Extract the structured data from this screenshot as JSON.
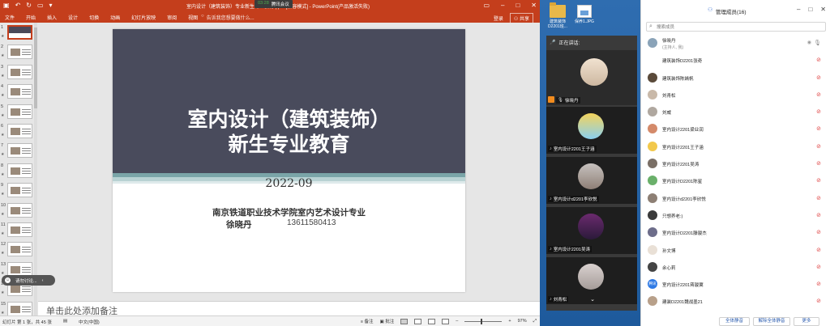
{
  "ppt": {
    "window_title": "室内设计（建筑装饰）专业新生专业教育.pptx [兼容模式] - PowerPoint(产品激活失败)",
    "meeting_badge": "腾讯会议",
    "meeting_time": "03:28",
    "tabs": [
      "文件",
      "开始",
      "插入",
      "设计",
      "切换",
      "动画",
      "幻灯片放映",
      "审阅",
      "视图"
    ],
    "tell_me": "告诉我您想要做什么...",
    "sign_in": "登录",
    "share": "共享",
    "slide": {
      "title_line1": "室内设计（建筑装饰）",
      "title_line2": "新生专业教育",
      "date": "2022-09",
      "school": "南京铁道职业技术学院室内艺术设计专业",
      "presenter": "徐晓丹",
      "phone": "13611580413"
    },
    "notes_placeholder": "单击此处添加备注",
    "chat_popup": "请勿讨论...",
    "status": {
      "slide_info": "幻灯片 第 1 张，共 45 张",
      "language": "中文(中国)",
      "notes": "备注",
      "comments": "批注",
      "zoom": "97%"
    },
    "thumb_numbers": [
      "1",
      "2",
      "3",
      "4",
      "5",
      "6",
      "7",
      "8",
      "9",
      "10",
      "11",
      "12",
      "13",
      "14",
      "15"
    ]
  },
  "desktop": {
    "icon1_label": "建筑装饰D2201班...",
    "icon2_label": "保养1.JPG"
  },
  "video": {
    "header": "正在讲话:",
    "tiles": [
      {
        "name": "徐晓丹"
      },
      {
        "name": "室内设计2201王子涵"
      },
      {
        "name": "室内设计d2201李欣悦"
      },
      {
        "name": "室内设计2201吴涛"
      },
      {
        "name": "刘青松"
      }
    ]
  },
  "members": {
    "title": "管理成员(16)",
    "search_placeholder": "搜索成员",
    "list": [
      {
        "name": "徐晓丹",
        "sub": "(主持人, 我)"
      },
      {
        "name": "建筑装饰D2201张奇"
      },
      {
        "name": "建筑装饰陈嫣帆"
      },
      {
        "name": "刘青松"
      },
      {
        "name": "刘威"
      },
      {
        "name": "室内设计2201梁业润"
      },
      {
        "name": "室内设计2201王子涵"
      },
      {
        "name": "室内设计2201吴涛"
      },
      {
        "name": "室内设计D2201陈星"
      },
      {
        "name": "室内设计d2201李欣悦"
      },
      {
        "name": "只想养老:)"
      },
      {
        "name": "室内设计D2201滕骏杰"
      },
      {
        "name": "孙文博"
      },
      {
        "name": "余心莉"
      },
      {
        "name": "室内设计2201蒋骏翼",
        "badge": "腾讯"
      },
      {
        "name": "建装D2201魏战墨21"
      }
    ],
    "buttons": [
      "全体静音",
      "解除全体静音",
      "更多"
    ]
  }
}
